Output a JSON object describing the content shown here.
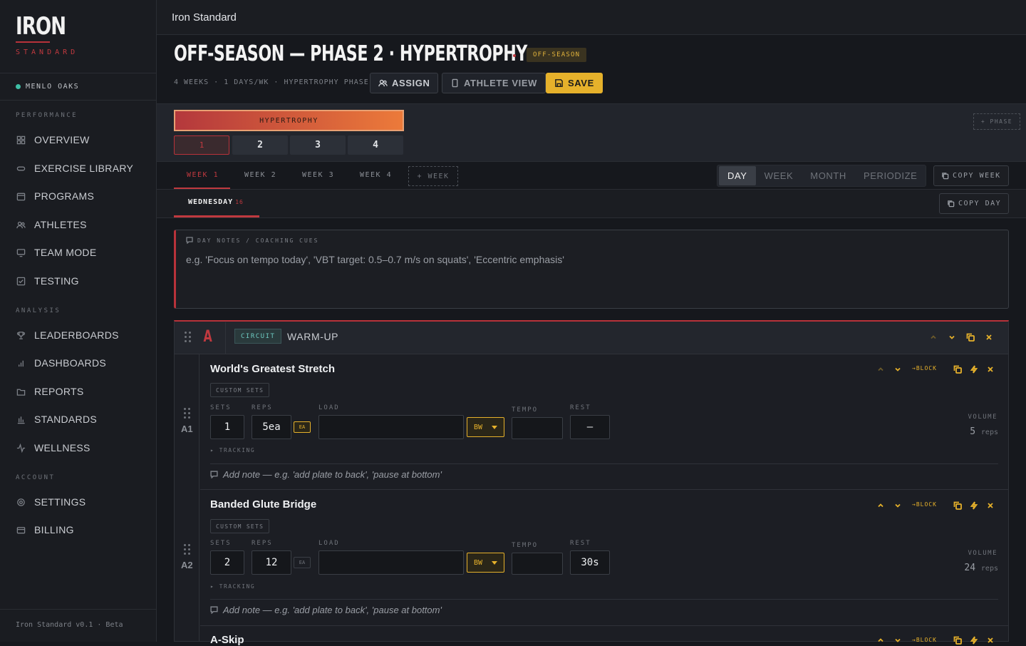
{
  "app": {
    "window_title": "Iron Standard",
    "version": "Iron Standard v0.1 · Beta"
  },
  "logo": {
    "main": "IRON",
    "sub": "STANDARD"
  },
  "org": {
    "name": "MENLO OAKS",
    "status_color": "#3fbfa6"
  },
  "sidebar": {
    "sections": [
      {
        "label": "PERFORMANCE",
        "items": [
          {
            "label": "OVERVIEW",
            "icon": "grid-icon"
          },
          {
            "label": "EXERCISE LIBRARY",
            "icon": "link-icon"
          },
          {
            "label": "PROGRAMS",
            "icon": "calendar-icon"
          },
          {
            "label": "ATHLETES",
            "icon": "users-icon"
          },
          {
            "label": "TEAM MODE",
            "icon": "monitor-icon"
          },
          {
            "label": "TESTING",
            "icon": "checkbox-icon"
          }
        ]
      },
      {
        "label": "ANALYSIS",
        "items": [
          {
            "label": "LEADERBOARDS",
            "icon": "trophy-icon"
          },
          {
            "label": "DASHBOARDS",
            "icon": "bar-chart-icon"
          },
          {
            "label": "REPORTS",
            "icon": "folder-icon"
          },
          {
            "label": "STANDARDS",
            "icon": "bars-icon"
          },
          {
            "label": "WELLNESS",
            "icon": "pulse-icon"
          }
        ]
      },
      {
        "label": "ACCOUNT",
        "items": [
          {
            "label": "SETTINGS",
            "icon": "gear-icon"
          },
          {
            "label": "BILLING",
            "icon": "card-icon"
          }
        ]
      }
    ]
  },
  "header": {
    "title": "OFF-SEASON — PHASE 2 · HYPERTROPHY",
    "badge": "OFF-SEASON",
    "meta": "4 WEEKS · 1 DAYS/WK · HYPERTROPHY PHASE",
    "assign_label": "ASSIGN",
    "athlete_view_label": "ATHLETE VIEW",
    "save_label": "SAVE"
  },
  "phase": {
    "name": "HYPERTROPHY",
    "weeks": [
      "1",
      "2",
      "3",
      "4"
    ],
    "selected_week": "1",
    "add_phase_label": "+ PHASE"
  },
  "week_tabs": {
    "tabs": [
      "WEEK 1",
      "WEEK 2",
      "WEEK 3",
      "WEEK 4"
    ],
    "selected": "WEEK 1",
    "add_label": "+ WEEK"
  },
  "views": {
    "options": [
      "DAY",
      "WEEK",
      "MONTH",
      "PERIODIZE"
    ],
    "selected": "DAY"
  },
  "copy_week_label": "COPY WEEK",
  "day_tab": {
    "name": "WEDNESDAY",
    "date": "16"
  },
  "copy_day_label": "COPY DAY",
  "notes": {
    "label": "DAY NOTES / COACHING CUES",
    "placeholder": "e.g. 'Focus on tempo today', 'VBT target: 0.5–0.7 m/s on squats', 'Eccentric emphasis'"
  },
  "block": {
    "letter": "A",
    "type": "CIRCUIT",
    "name": "WARM-UP"
  },
  "labels": {
    "sets": "SETS",
    "reps": "REPS",
    "load": "LOAD",
    "tempo": "TEMPO",
    "rest": "REST",
    "volume": "VOLUME",
    "tracking": "▸ TRACKING",
    "custom_sets": "CUSTOM SETS",
    "ea": "EA",
    "to_block": "BLOCK",
    "add_note": "Add note — e.g. 'add plate to back', 'pause at bottom'",
    "reps_unit": "reps"
  },
  "exercises": [
    {
      "id": "A1",
      "name": "World's Greatest Stretch",
      "sets": "1",
      "reps": "5ea",
      "ea_active": true,
      "load": "",
      "load_unit": "BW",
      "tempo": "",
      "rest": "–",
      "volume": "5"
    },
    {
      "id": "A2",
      "name": "Banded Glute Bridge",
      "sets": "2",
      "reps": "12",
      "ea_active": false,
      "load": "",
      "load_unit": "BW",
      "tempo": "",
      "rest": "30s",
      "volume": "24"
    },
    {
      "id": "A3",
      "name": "A-Skip"
    }
  ],
  "colors": {
    "accent_red": "#c0393f",
    "accent_gold": "#e6b12b",
    "teal": "#6dc9c0"
  }
}
